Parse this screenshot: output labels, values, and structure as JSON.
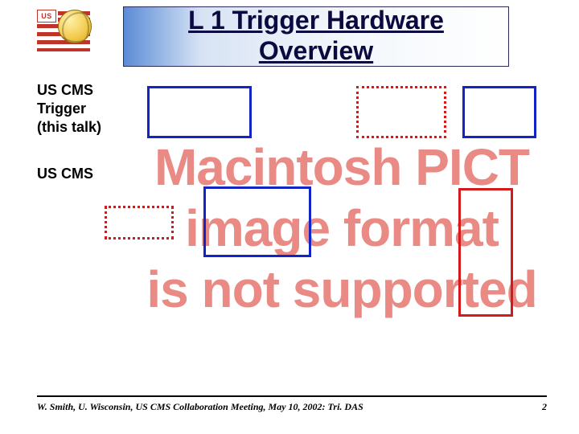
{
  "logo": {
    "canton": "US"
  },
  "header": {
    "title_line1": "L 1 Trigger Hardware",
    "title_line2": "Overview"
  },
  "labels": {
    "a_line1": "US CMS",
    "a_line2": "Trigger",
    "a_line3": "(this talk)",
    "b_line1": "US CMS"
  },
  "pict": {
    "line1": "Macintosh PICT",
    "line2": "image format",
    "line3": "is not supported"
  },
  "footer": {
    "left": "W. Smith, U. Wisconsin, US CMS Collaboration Meeting, May 10, 2002: Tri. DAS",
    "page": "2"
  }
}
